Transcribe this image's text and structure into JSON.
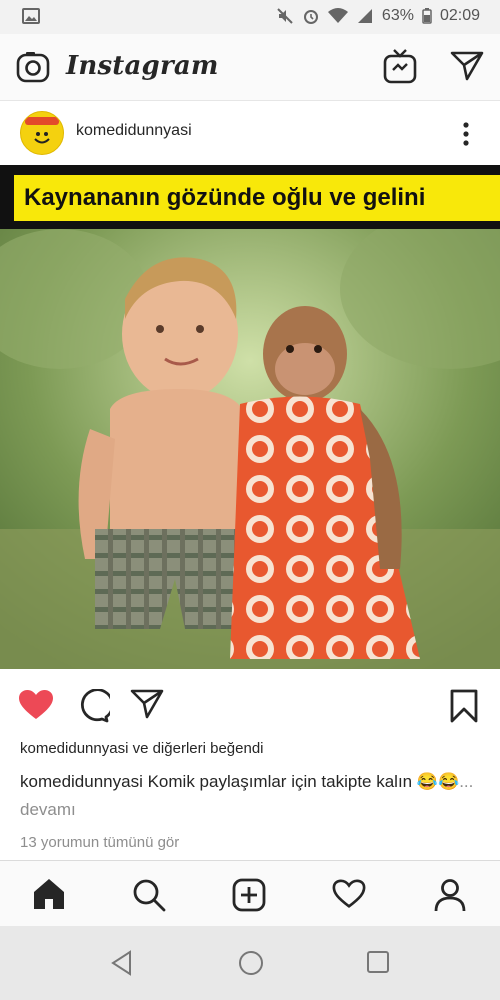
{
  "status_bar": {
    "battery": "63%",
    "time": "02:09"
  },
  "app_header": {
    "logo": "Instagram",
    "icons": [
      "camera-icon",
      "igtv-icon",
      "direct-message-icon"
    ]
  },
  "post": {
    "username": "komedidunnyasi",
    "image_caption_text": "Kaynananın gözünde oğlu ve gelini",
    "likes": {
      "user": "komedidunnyasi",
      "connector": "ve",
      "others": "diğerleri",
      "verb": "beğendi"
    },
    "caption": {
      "username": "komedidunnyasi",
      "text": "Komik paylaşımlar için takipte kalın 😂😂",
      "more": "... devamı"
    },
    "comments_link": "13 yorumun tümünü gör"
  },
  "colors": {
    "like_red": "#ed4956",
    "banner_yellow": "#f8e80a",
    "text_dark": "#262626",
    "text_grey": "#8e8e8e"
  }
}
